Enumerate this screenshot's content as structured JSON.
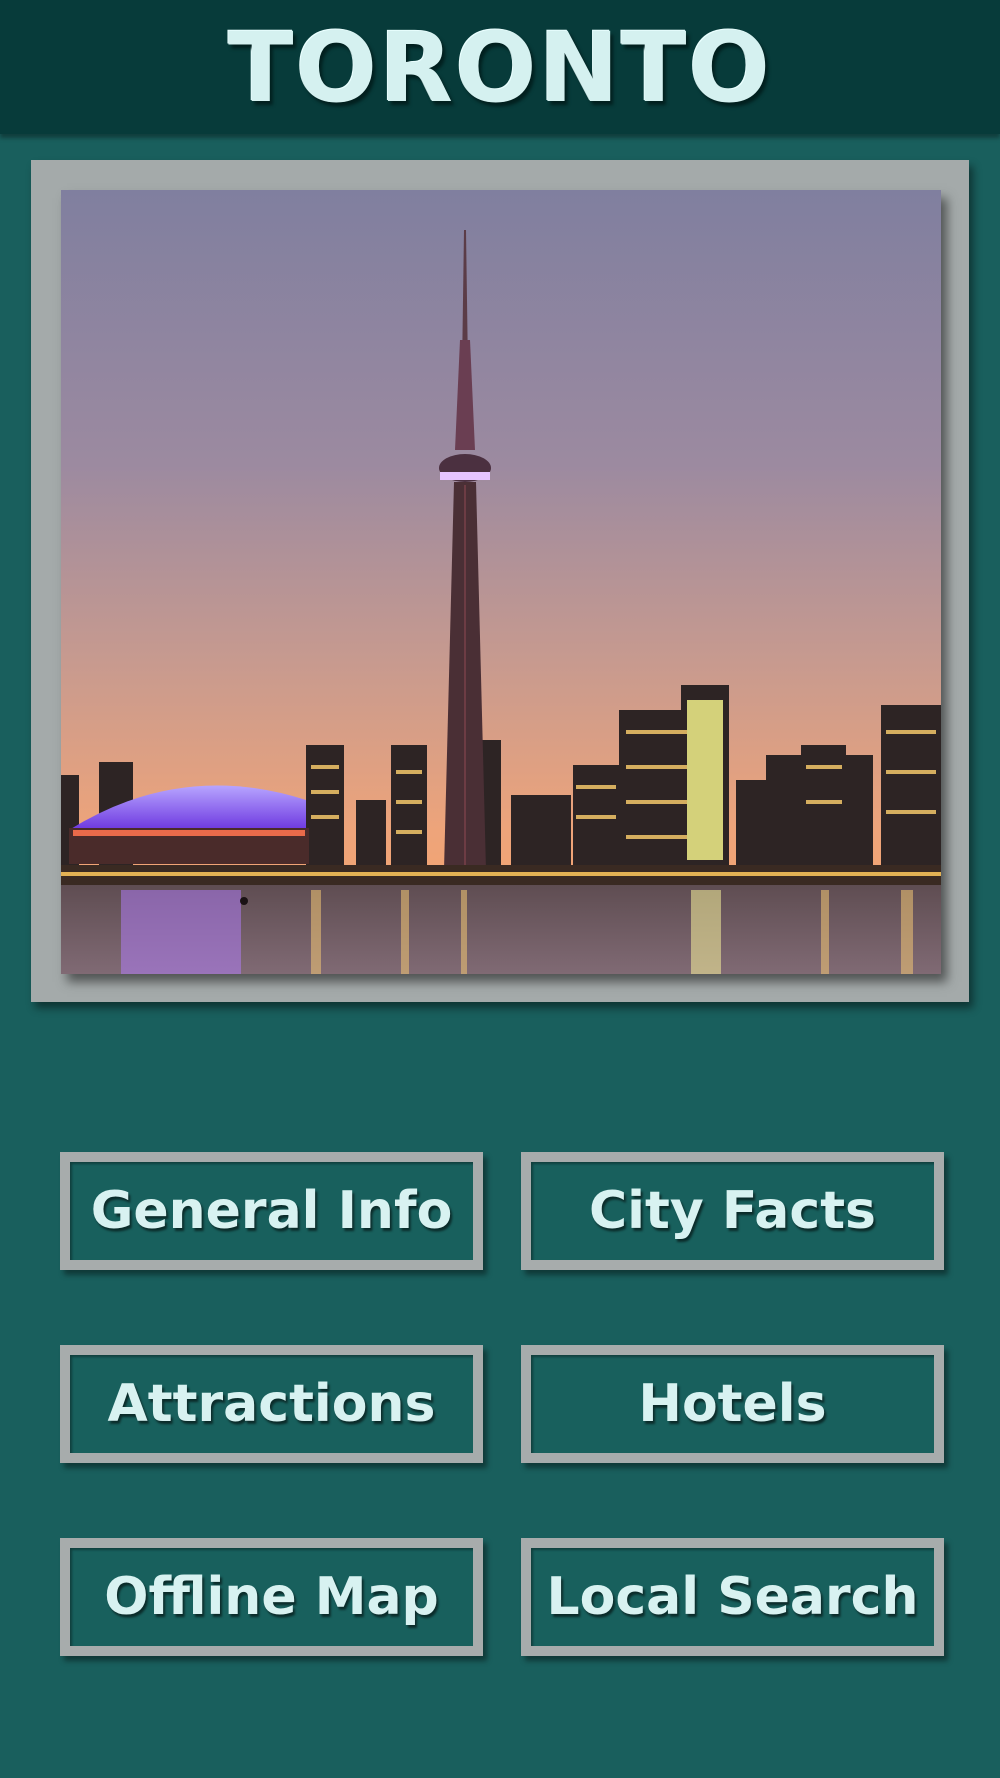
{
  "header": {
    "title": "TORONTO"
  },
  "hero": {
    "image": "toronto-skyline-cn-tower-dusk"
  },
  "menu": {
    "general_info": "General Info",
    "city_facts": "City Facts",
    "attractions": "Attractions",
    "hotels": "Hotels",
    "offline_map": "Offline Map",
    "local_search": "Local Search"
  },
  "colors": {
    "background": "#195f5d",
    "header": "#073b3a",
    "frame": "#a4aaaa",
    "text": "#d8f2f1"
  }
}
